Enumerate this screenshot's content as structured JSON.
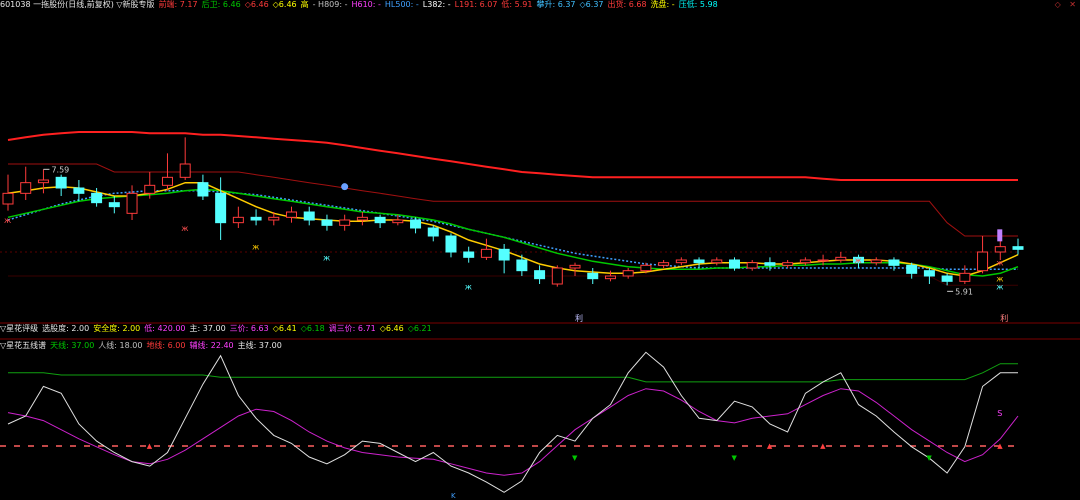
{
  "main_header": [
    {
      "text": "601038 一拖股份(日线,前复权) ▽新股专版",
      "color": "#e6e6e6",
      "bold": false
    },
    {
      "text": "前端: 7.17",
      "color": "#ff3b3b"
    },
    {
      "text": "后卫: 6.46",
      "color": "#00c800"
    },
    {
      "text": "◇6.46",
      "color": "#ff3b3b"
    },
    {
      "text": "◇6.46",
      "color": "#ffff00"
    },
    {
      "text": "高",
      "color": "#ffff00"
    },
    {
      "text": "- H809: -",
      "color": "#c0c0c0"
    },
    {
      "text": "H610: -",
      "color": "#ff40ff"
    },
    {
      "text": "HL500: -",
      "color": "#40a0ff"
    },
    {
      "text": "L382: -",
      "color": "#ffffff"
    },
    {
      "text": "L191: 6.07",
      "color": "#ff3b3b"
    },
    {
      "text": "低: 5.91",
      "color": "#ff3b3b"
    },
    {
      "text": "攀升: 6.37",
      "color": "#40c0ff"
    },
    {
      "text": "◇6.37",
      "color": "#40c0ff"
    },
    {
      "text": "出货: 6.68",
      "color": "#ff3b3b"
    },
    {
      "text": "洗盘: -",
      "color": "#ffff00"
    },
    {
      "text": "压低: 5.98",
      "color": "#00ffff"
    }
  ],
  "panel2_header": [
    {
      "text": "▽星花评级",
      "color": "#e6e6e6"
    },
    {
      "text": "选股度: 2.00",
      "color": "#e6e6e6"
    },
    {
      "text": "安全度: 2.00",
      "color": "#ffff00"
    },
    {
      "text": "低: 420.00",
      "color": "#ff40ff"
    },
    {
      "text": "主: 37.00",
      "color": "#e6e6e6"
    },
    {
      "text": "三价: 6.63",
      "color": "#ff40ff"
    },
    {
      "text": "◇6.41",
      "color": "#ffff00"
    },
    {
      "text": "◇6.18",
      "color": "#00c800"
    },
    {
      "text": "调三价: 6.71",
      "color": "#ff40ff"
    },
    {
      "text": "◇6.46",
      "color": "#ffff00"
    },
    {
      "text": "◇6.21",
      "color": "#00c800"
    }
  ],
  "panel3_header": [
    {
      "text": "▽星花五线谱",
      "color": "#e6e6e6"
    },
    {
      "text": "天线: 37.00",
      "color": "#00c800"
    },
    {
      "text": "人线: 18.00",
      "color": "#c0c0c0"
    },
    {
      "text": "地线: 6.00",
      "color": "#ff3b3b"
    },
    {
      "text": "辅线: 22.40",
      "color": "#ff40ff"
    },
    {
      "text": "主线: 37.00",
      "color": "#e6e6e6"
    }
  ],
  "top_right_icons": [
    "alarm-icon",
    "settings-icon"
  ],
  "colors": {
    "up": "#ff3b3b",
    "down": "#54ffff",
    "ma_short": "#ffcc00",
    "ma_mid": "#00c800",
    "ma_long": "#40a0ff",
    "red_band": "#ff2020",
    "dark_band": "#a01010",
    "white_line": "#e0e0e0",
    "magenta_line": "#cc22cc",
    "green_line": "#10a010"
  },
  "chart_data": {
    "type": "candlestick",
    "annotations": {
      "high_label": "7.59",
      "low_label": "5.91",
      "flag_label": "利",
      "s_label": "S",
      "k_label": "K"
    },
    "candles": [
      [
        6.52,
        6.6,
        6.74,
        6.47
      ],
      [
        6.6,
        6.68,
        6.8,
        6.55
      ],
      [
        6.68,
        6.7,
        6.78,
        6.6
      ],
      [
        6.72,
        6.64,
        6.74,
        6.58
      ],
      [
        6.64,
        6.6,
        6.7,
        6.54
      ],
      [
        6.6,
        6.53,
        6.64,
        6.5
      ],
      [
        6.53,
        6.5,
        6.58,
        6.45
      ],
      [
        6.45,
        6.6,
        6.66,
        6.4
      ],
      [
        6.6,
        6.66,
        6.76,
        6.56
      ],
      [
        6.66,
        6.72,
        6.9,
        6.62
      ],
      [
        6.72,
        6.82,
        7.02,
        6.7
      ],
      [
        6.68,
        6.58,
        6.74,
        6.55
      ],
      [
        6.6,
        6.38,
        6.72,
        6.25
      ],
      [
        6.38,
        6.42,
        6.5,
        6.34
      ],
      [
        6.42,
        6.4,
        6.48,
        6.36
      ],
      [
        6.4,
        6.42,
        6.46,
        6.36
      ],
      [
        6.42,
        6.46,
        6.5,
        6.38
      ],
      [
        6.46,
        6.4,
        6.5,
        6.36
      ],
      [
        6.4,
        6.36,
        6.44,
        6.32
      ],
      [
        6.36,
        6.4,
        6.44,
        6.32
      ],
      [
        6.4,
        6.42,
        6.46,
        6.36
      ],
      [
        6.42,
        6.38,
        6.44,
        6.34
      ],
      [
        6.38,
        6.4,
        6.44,
        6.36
      ],
      [
        6.4,
        6.34,
        6.42,
        6.3
      ],
      [
        6.34,
        6.28,
        6.36,
        6.24
      ],
      [
        6.28,
        6.16,
        6.3,
        6.12
      ],
      [
        6.16,
        6.12,
        6.2,
        6.08
      ],
      [
        6.12,
        6.18,
        6.26,
        6.1
      ],
      [
        6.18,
        6.1,
        6.22,
        6.0
      ],
      [
        6.1,
        6.02,
        6.14,
        5.98
      ],
      [
        6.02,
        5.96,
        6.06,
        5.92
      ],
      [
        5.92,
        6.04,
        6.06,
        5.9
      ],
      [
        6.04,
        6.06,
        6.08,
        5.98
      ],
      [
        6.0,
        5.96,
        6.04,
        5.92
      ],
      [
        5.96,
        5.98,
        6.02,
        5.94
      ],
      [
        5.98,
        6.02,
        6.04,
        5.96
      ],
      [
        6.02,
        6.06,
        6.08,
        6.0
      ],
      [
        6.06,
        6.08,
        6.1,
        6.04
      ],
      [
        6.08,
        6.1,
        6.12,
        6.06
      ],
      [
        6.1,
        6.08,
        6.12,
        6.04
      ],
      [
        6.08,
        6.1,
        6.12,
        6.06
      ],
      [
        6.1,
        6.04,
        6.12,
        6.02
      ],
      [
        6.04,
        6.08,
        6.1,
        6.02
      ],
      [
        6.08,
        6.06,
        6.12,
        6.02
      ],
      [
        6.06,
        6.08,
        6.1,
        6.04
      ],
      [
        6.08,
        6.1,
        6.12,
        6.06
      ],
      [
        6.1,
        6.1,
        6.14,
        6.06
      ],
      [
        6.1,
        6.12,
        6.16,
        6.08
      ],
      [
        6.12,
        6.08,
        6.14,
        6.04
      ],
      [
        6.08,
        6.1,
        6.12,
        6.06
      ],
      [
        6.1,
        6.06,
        6.12,
        6.02
      ],
      [
        6.06,
        6.0,
        6.08,
        5.96
      ],
      [
        6.02,
        5.98,
        6.04,
        5.92
      ],
      [
        5.98,
        5.94,
        6.0,
        5.91
      ],
      [
        5.94,
        6.0,
        6.06,
        5.92
      ],
      [
        6.02,
        6.16,
        6.28,
        6.0
      ],
      [
        6.16,
        6.2,
        6.26,
        6.1
      ],
      [
        6.2,
        6.18,
        6.26,
        6.14
      ]
    ],
    "ma_short": [
      6.6,
      6.62,
      6.64,
      6.65,
      6.64,
      6.61,
      6.58,
      6.58,
      6.6,
      6.63,
      6.68,
      6.68,
      6.62,
      6.56,
      6.5,
      6.45,
      6.42,
      6.41,
      6.4,
      6.39,
      6.39,
      6.4,
      6.4,
      6.39,
      6.36,
      6.31,
      6.25,
      6.21,
      6.17,
      6.12,
      6.07,
      6.04,
      6.02,
      6.01,
      6.0,
      6.0,
      6.01,
      6.03,
      6.05,
      6.07,
      6.08,
      6.08,
      6.08,
      6.07,
      6.07,
      6.08,
      6.09,
      6.1,
      6.1,
      6.1,
      6.09,
      6.07,
      6.04,
      6.0,
      5.98,
      6.02,
      6.08,
      6.14
    ],
    "ma_mid": [
      6.42,
      6.45,
      6.48,
      6.51,
      6.54,
      6.56,
      6.57,
      6.58,
      6.59,
      6.6,
      6.62,
      6.63,
      6.62,
      6.6,
      6.58,
      6.56,
      6.54,
      6.52,
      6.5,
      6.48,
      6.46,
      6.45,
      6.44,
      6.42,
      6.4,
      6.37,
      6.33,
      6.3,
      6.27,
      6.23,
      6.19,
      6.15,
      6.12,
      6.09,
      6.07,
      6.05,
      6.04,
      6.03,
      6.03,
      6.03,
      6.04,
      6.04,
      6.05,
      6.05,
      6.06,
      6.06,
      6.07,
      6.07,
      6.08,
      6.08,
      6.08,
      6.07,
      6.05,
      6.02,
      5.99,
      5.98,
      6.0,
      6.05
    ],
    "ma_long": [
      6.4,
      6.44,
      6.48,
      6.52,
      6.55,
      6.58,
      6.6,
      6.61,
      6.62,
      6.62,
      6.62,
      6.62,
      6.61,
      6.6,
      6.59,
      6.57,
      6.55,
      6.53,
      6.51,
      6.49,
      6.47,
      6.45,
      6.43,
      6.41,
      6.39,
      6.36,
      6.33,
      6.3,
      6.27,
      6.24,
      6.21,
      6.18,
      6.15,
      6.13,
      6.11,
      6.09,
      6.07,
      6.06,
      6.05,
      6.04,
      6.04,
      6.04,
      6.04,
      6.04,
      6.04,
      6.04,
      6.04,
      6.04,
      6.04,
      6.04,
      6.04,
      6.04,
      6.04,
      6.03,
      6.03,
      6.03,
      6.03,
      6.03
    ],
    "red_band": [
      7.0,
      7.02,
      7.04,
      7.05,
      7.06,
      7.06,
      7.06,
      7.06,
      7.05,
      7.05,
      7.05,
      7.04,
      7.04,
      7.03,
      7.02,
      7.01,
      7.0,
      6.99,
      6.98,
      6.96,
      6.94,
      6.92,
      6.9,
      6.88,
      6.86,
      6.84,
      6.82,
      6.8,
      6.78,
      6.76,
      6.75,
      6.74,
      6.73,
      6.72,
      6.72,
      6.72,
      6.72,
      6.72,
      6.72,
      6.72,
      6.72,
      6.72,
      6.72,
      6.72,
      6.72,
      6.72,
      6.71,
      6.7,
      6.7,
      6.7,
      6.7,
      6.7,
      6.7,
      6.7,
      6.7,
      6.7,
      6.7,
      6.7
    ],
    "upper_band": [
      6.82,
      6.82,
      6.82,
      6.82,
      6.82,
      6.82,
      6.76,
      6.76,
      6.76,
      6.76,
      6.76,
      6.76,
      6.76,
      6.76,
      6.74,
      6.72,
      6.7,
      6.68,
      6.66,
      6.64,
      6.62,
      6.6,
      6.58,
      6.56,
      6.54,
      6.54,
      6.54,
      6.54,
      6.54,
      6.54,
      6.54,
      6.54,
      6.54,
      6.54,
      6.54,
      6.54,
      6.54,
      6.54,
      6.54,
      6.54,
      6.54,
      6.54,
      6.54,
      6.54,
      6.54,
      6.54,
      6.54,
      6.54,
      6.54,
      6.54,
      6.54,
      6.54,
      6.54,
      6.38,
      6.28,
      6.28,
      6.28,
      6.28
    ],
    "lower_band": [
      5.98,
      5.98,
      5.98,
      5.98,
      5.98,
      5.98,
      5.98,
      5.98,
      5.98,
      5.98,
      5.98,
      5.98,
      5.98,
      5.98,
      5.98,
      5.98,
      5.98,
      5.98,
      5.98,
      5.98,
      5.98,
      5.98,
      5.98,
      5.98,
      5.98,
      5.98,
      5.98,
      5.98,
      5.98,
      5.98,
      5.98,
      5.98,
      5.98,
      5.98,
      5.98,
      5.98,
      5.98,
      5.98,
      5.98,
      5.98,
      5.98,
      5.98,
      5.98,
      5.98,
      5.98,
      5.98,
      5.98,
      5.98,
      5.98,
      5.98,
      5.98,
      5.98,
      5.98,
      5.91,
      5.91,
      5.91,
      5.91,
      5.91
    ],
    "osc_white": [
      55,
      62,
      88,
      82,
      55,
      40,
      30,
      22,
      18,
      30,
      60,
      90,
      115,
      80,
      60,
      45,
      38,
      26,
      20,
      28,
      40,
      38,
      30,
      22,
      30,
      18,
      12,
      4,
      -5,
      5,
      30,
      45,
      40,
      60,
      72,
      100,
      118,
      105,
      80,
      60,
      58,
      75,
      70,
      55,
      48,
      82,
      92,
      100,
      72,
      62,
      48,
      35,
      25,
      12,
      35,
      88,
      100,
      100
    ],
    "osc_magenta": [
      65,
      62,
      58,
      50,
      42,
      35,
      28,
      22,
      20,
      24,
      32,
      42,
      52,
      62,
      68,
      66,
      58,
      48,
      40,
      34,
      30,
      28,
      26,
      25,
      24,
      20,
      16,
      12,
      10,
      12,
      22,
      36,
      50,
      60,
      70,
      80,
      86,
      84,
      76,
      66,
      58,
      56,
      60,
      62,
      64,
      72,
      80,
      86,
      84,
      74,
      62,
      50,
      40,
      30,
      22,
      28,
      42,
      62
    ],
    "osc_green": [
      100,
      100,
      100,
      98,
      98,
      98,
      98,
      98,
      98,
      98,
      98,
      98,
      96,
      96,
      96,
      96,
      96,
      96,
      96,
      96,
      96,
      96,
      96,
      96,
      96,
      96,
      96,
      96,
      96,
      96,
      96,
      96,
      96,
      96,
      96,
      96,
      92,
      92,
      92,
      92,
      92,
      92,
      92,
      92,
      92,
      92,
      92,
      94,
      94,
      94,
      94,
      94,
      94,
      94,
      94,
      100,
      108,
      108
    ]
  }
}
